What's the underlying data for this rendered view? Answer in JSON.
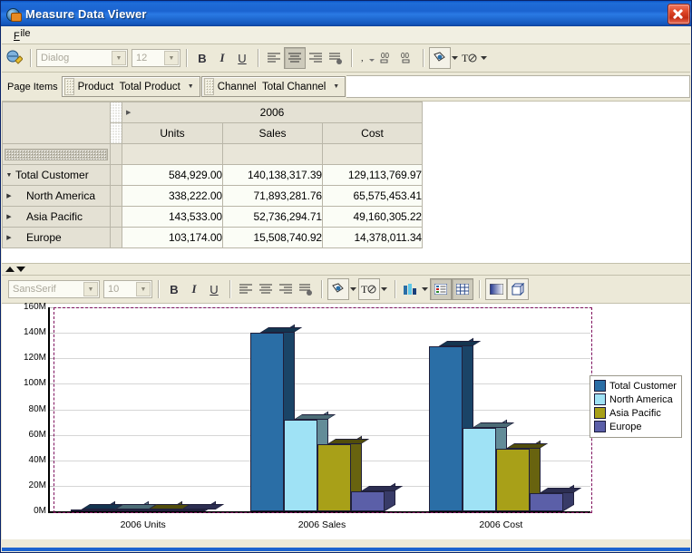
{
  "window": {
    "title": "Measure Data Viewer",
    "icon": "chart-globe-icon",
    "close_label": "×"
  },
  "menu": {
    "items": [
      {
        "label": "File"
      }
    ]
  },
  "toolbar_top": {
    "style_icon": "paint-style-icon",
    "font_name": "Dialog",
    "font_size": "12",
    "bold": "B",
    "italic": "I",
    "underline": "U",
    "align_left": "align-left-icon",
    "align_center": "align-center-icon",
    "align_right": "align-right-icon",
    "align_justify": "align-justify-icon",
    "comma_format": "comma-format-icon",
    "quote_left": "quote-left-icon",
    "quote_right": "quote-right-icon",
    "fill_color": "fill-color-icon",
    "text_color": "text-color-icon"
  },
  "page_items": {
    "label": "Page Items",
    "chips": [
      {
        "dimension": "Product",
        "value": "Total Product",
        "caret": "▼"
      },
      {
        "dimension": "Channel",
        "value": "Total Channel",
        "caret": "▼"
      }
    ]
  },
  "grid": {
    "year_header": "2006",
    "year_caret": "▶",
    "columns": [
      "Units",
      "Sales",
      "Cost"
    ],
    "rows": [
      {
        "label": "Total Customer",
        "caret": "▼",
        "indent": 0,
        "values": [
          "584,929.00",
          "140,138,317.39",
          "129,113,769.97"
        ]
      },
      {
        "label": "North America",
        "caret": "▶",
        "indent": 1,
        "values": [
          "338,222.00",
          "71,893,281.76",
          "65,575,453.41"
        ]
      },
      {
        "label": "Asia Pacific",
        "caret": "▶",
        "indent": 1,
        "values": [
          "143,533.00",
          "52,736,294.71",
          "49,160,305.22"
        ]
      },
      {
        "label": "Europe",
        "caret": "▶",
        "indent": 1,
        "values": [
          "103,174.00",
          "15,508,740.92",
          "14,378,011.34"
        ]
      }
    ]
  },
  "toolbar_chart": {
    "font_name": "SansSerif",
    "font_size": "10",
    "bold": "B",
    "italic": "I",
    "underline": "U",
    "align_left": "align-left-icon",
    "align_center": "align-center-icon",
    "align_right": "align-right-icon",
    "align_justify": "align-justify-icon",
    "fill_color": "fill-color-icon",
    "text_color": "text-color-icon",
    "chart_type": "bar-chart-icon",
    "legend_toggle": "legend-icon",
    "grid_toggle": "grid-icon",
    "gradient_toggle": "gradient-icon",
    "depth_toggle": "cube-3d-icon"
  },
  "chart_data": {
    "type": "bar",
    "title": "",
    "xlabel": "",
    "ylabel": "",
    "categories": [
      "2006 Units",
      "2006 Sales",
      "2006 Cost"
    ],
    "ylim": [
      0,
      160000000
    ],
    "yticks": [
      "0M",
      "20M",
      "40M",
      "60M",
      "80M",
      "100M",
      "120M",
      "140M",
      "160M"
    ],
    "ytick_values": [
      0,
      20000000,
      40000000,
      60000000,
      80000000,
      100000000,
      120000000,
      140000000,
      160000000
    ],
    "grid": true,
    "legend_position": "right",
    "series": [
      {
        "name": "Total Customer",
        "color": "#2a6ea6",
        "values": [
          584929,
          140138317.39,
          129113769.97
        ]
      },
      {
        "name": "North America",
        "color": "#9fe2f5",
        "values": [
          338222,
          71893281.76,
          65575453.41
        ]
      },
      {
        "name": "Asia Pacific",
        "color": "#a8a018",
        "values": [
          143533,
          52736294.71,
          49160305.22
        ]
      },
      {
        "name": "Europe",
        "color": "#5b5fa8",
        "values": [
          103174,
          15508740.92,
          14378011.34
        ]
      }
    ]
  }
}
